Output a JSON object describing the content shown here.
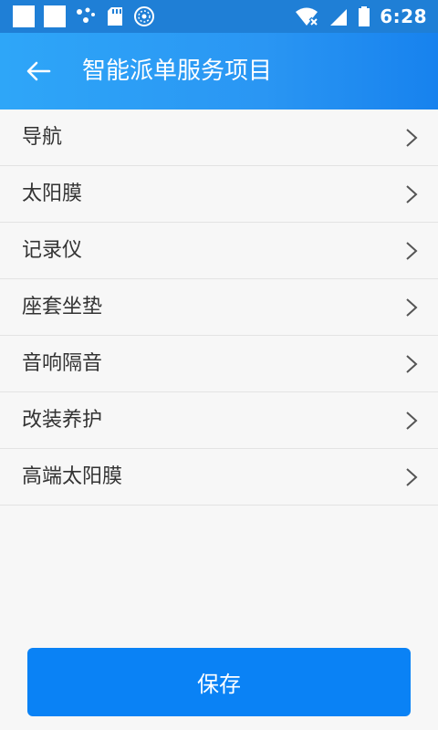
{
  "status_bar": {
    "time": "6:28",
    "icons": [
      "notification-square-icon",
      "notification-square-icon",
      "share-dots-icon",
      "sd-card-icon",
      "sync-globe-icon",
      "wifi-off-icon",
      "signal-icon",
      "battery-icon"
    ]
  },
  "app_bar": {
    "back_icon": "arrow-left-icon",
    "title": "智能派单服务项目"
  },
  "list": {
    "items": [
      {
        "label": "导航"
      },
      {
        "label": "太阳膜"
      },
      {
        "label": "记录仪"
      },
      {
        "label": "座套坐垫"
      },
      {
        "label": "音响隔音"
      },
      {
        "label": "改装养护"
      },
      {
        "label": "高端太阳膜"
      }
    ],
    "chevron_icon": "chevron-right-icon"
  },
  "footer": {
    "save_label": "保存"
  },
  "colors": {
    "primary": "#0a82f5",
    "app_bar_start": "#2ea6f8",
    "app_bar_end": "#1782ee",
    "status_bar": "#1f7fd6",
    "background": "#f7f7f7",
    "text": "#333333"
  }
}
